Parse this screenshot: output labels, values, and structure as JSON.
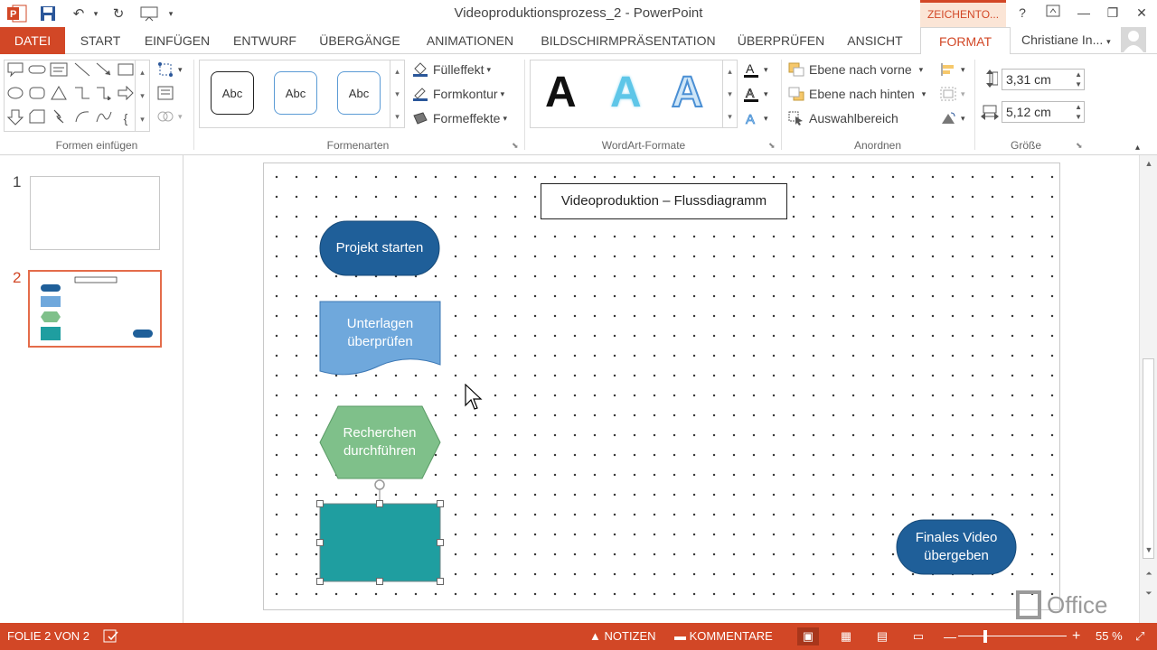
{
  "window": {
    "title": "Videoproduktionsprozess_2 - PowerPoint",
    "context_tab": "ZEICHENTO...",
    "help": "?"
  },
  "tabs": [
    "DATEI",
    "START",
    "EINFÜGEN",
    "ENTWURF",
    "ÜBERGÄNGE",
    "ANIMATIONEN",
    "BILDSCHIRMPRÄSENTATION",
    "ÜBERPRÜFEN",
    "ANSICHT",
    "FORMAT"
  ],
  "active_tab": "FORMAT",
  "user": {
    "name": "Christiane In..."
  },
  "ribbon": {
    "groups": {
      "insert_shapes": "Formen einfügen",
      "shape_styles": "Formenarten",
      "wordart": "WordArt-Formate",
      "arrange": "Anordnen",
      "size": "Größe"
    },
    "style_gallery": [
      "Abc",
      "Abc",
      "Abc"
    ],
    "fill": "Fülleffekt",
    "outline": "Formkontur",
    "effects": "Formeffekte",
    "wordart_gallery": [
      "A",
      "A",
      "A"
    ],
    "bring_forward": "Ebene nach vorne",
    "send_backward": "Ebene nach hinten",
    "selection_pane": "Auswahlbereich",
    "height": "3,31  cm",
    "width": "5,12  cm"
  },
  "slides": [
    {
      "number": "1"
    },
    {
      "number": "2",
      "selected": true
    }
  ],
  "slide": {
    "title": "Videoproduktion – Flussdiagramm",
    "shapes": [
      {
        "label": "Projekt starten",
        "type": "terminator",
        "color": "#1f5f99"
      },
      {
        "label": "Unterlagen überprüfen",
        "type": "document",
        "color": "#6fa8dc"
      },
      {
        "label": "Recherchen durchführen",
        "type": "preparation",
        "color": "#7fc08a"
      },
      {
        "label": "",
        "type": "process",
        "color": "#1f9ea0",
        "selected": true
      },
      {
        "label": "Finales Video übergeben",
        "type": "terminator",
        "color": "#1f5f99"
      }
    ]
  },
  "watermark": "Office",
  "status": {
    "slide": "FOLIE 2 VON 2",
    "notes": "NOTIZEN",
    "comments": "KOMMENTARE",
    "zoom": "55 %"
  },
  "colors": {
    "accent": "#d24726",
    "thumb_select": "#e46c4a"
  }
}
